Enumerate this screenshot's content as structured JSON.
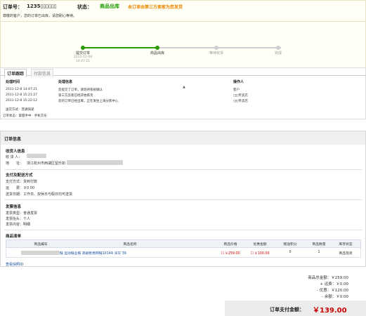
{
  "header": {
    "ordernum_label": "订单号：",
    "ordernum": "1235▯▯▯▯▯▯",
    "status_label": "状态：",
    "status_value": "商品出库",
    "status_note": "本订单由第三方卖家为您发货",
    "notice": "尊敬的客户，您的订单已出库，请您耐心等待。"
  },
  "progress": {
    "steps": [
      {
        "label": "提交订单",
        "time": "2011-12-08\n14:47:21"
      },
      {
        "label": "商品出库",
        "time": ""
      },
      {
        "label": "等待收货",
        "time": ""
      },
      {
        "label": "完成",
        "time": ""
      }
    ],
    "colors": {
      "done": "#2a9a00",
      "todo": "#cfcfcf"
    }
  },
  "tracking": {
    "tabs": [
      "订单跟踪",
      "付款信息"
    ],
    "headers": [
      "处理时间",
      "处理信息",
      "操作人"
    ],
    "rows": [
      {
        "time": "2011-12-8 14:47:21",
        "info": "您提交了订单，请等待系统确认",
        "op": "客户"
      },
      {
        "time": "2011-12-8 15:21:27",
        "info": "第三方卖家已经开始拣货",
        "op": "▯▯▯专卖店"
      },
      {
        "time": "2011-12-8 15:22:12",
        "info": "您的订单已经出库，正在发往上海分拣中心",
        "op": "▯▯▯专卖店"
      }
    ],
    "carrier": "送货方式：普通快递",
    "order_status": "订单状态：掌握手中 · 手机京东"
  },
  "info": {
    "title": "订单信息",
    "receiver_title": "收货人信息",
    "receiver_name_label": "收 货 人：",
    "receiver_addr_label": "地　　址：",
    "receiver_addr": "浙江杭州市西湖区留乐如",
    "pay_title": "支付及配送方式",
    "pay_method": "支付方式：货到付款",
    "freight": "运　　费：￥0.00",
    "delivery": "送货日期：工作日、双休日与假日均可送货",
    "invoice_title": "发票信息",
    "invoice_type": "发票类型：普通发票",
    "invoice_header": "发票抬头：个人",
    "invoice_content": "发票内容：明细",
    "product_title": "商品清单"
  },
  "products": {
    "headers": [
      "商品编号",
      "商品名称",
      "商品价格",
      "优惠金额",
      "赠送积分",
      "商品数量",
      "库存状态"
    ],
    "rows": [
      {
        "id": "▯▯▯▯▯▯",
        "name": "鞋  运动鞋业鞋  高级拒绝网鞋1014A 深灰 39",
        "price": "￥259.00",
        "discount": "￥100.00",
        "points": "0",
        "qty": "1",
        "stock": "商品现货"
      }
    ],
    "snapshot": "查看快照ID"
  },
  "totals": {
    "goods_total": "商品总金额：￥259.00",
    "freight": "+ 运费：￥0.00",
    "discount": "- 优惠：￥120.00",
    "balance": "- 余额：￥0.00",
    "pay_label": "订单支付金额：",
    "pay_amount": "￥139.00"
  }
}
